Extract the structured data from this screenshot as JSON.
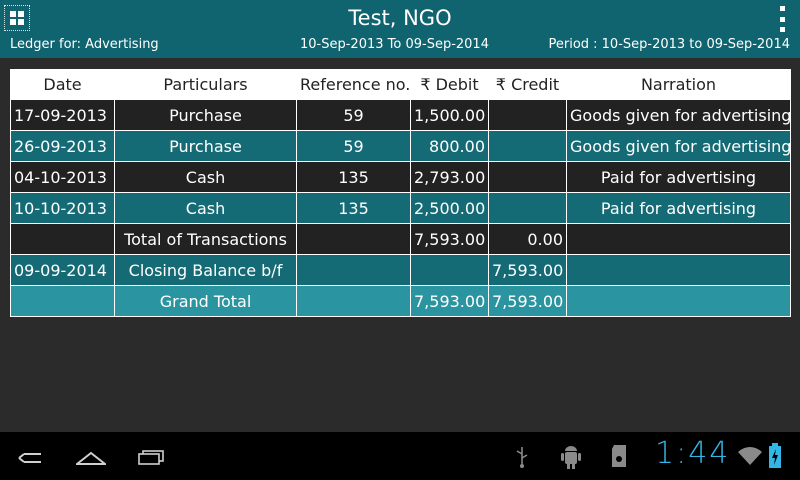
{
  "header": {
    "title": "Test, NGO",
    "ledger_label": "Ledger for: Advertising",
    "date_range": "10-Sep-2013 To 09-Sep-2014",
    "period": "Period : 10-Sep-2013 to 09-Sep-2014",
    "grid_icon": "grid-icon",
    "menu_icon": "overflow-menu-icon"
  },
  "table": {
    "columns": [
      "Date",
      "Particulars",
      "Reference no.",
      "₹ Debit",
      "₹ Credit",
      "Narration"
    ],
    "rows": [
      {
        "date": "17-09-2013",
        "particulars": "Purchase",
        "ref": "59",
        "debit": "1,500.00",
        "credit": "",
        "narration": "Goods given for advertising"
      },
      {
        "date": "26-09-2013",
        "particulars": "Purchase",
        "ref": "59",
        "debit": "800.00",
        "credit": "",
        "narration": "Goods given for advertising"
      },
      {
        "date": "04-10-2013",
        "particulars": "Cash",
        "ref": "135",
        "debit": "2,793.00",
        "credit": "",
        "narration": "Paid for advertising"
      },
      {
        "date": "10-10-2013",
        "particulars": "Cash",
        "ref": "135",
        "debit": "2,500.00",
        "credit": "",
        "narration": "Paid for advertising"
      },
      {
        "date": "",
        "particulars": "Total of Transactions",
        "ref": "",
        "debit": "7,593.00",
        "credit": "0.00",
        "narration": ""
      },
      {
        "date": "09-09-2014",
        "particulars": "Closing Balance b/f",
        "ref": "",
        "debit": "",
        "credit": "7,593.00",
        "narration": ""
      },
      {
        "date": "",
        "particulars": "Grand Total",
        "ref": "",
        "debit": "7,593.00",
        "credit": "7,593.00",
        "narration": ""
      }
    ]
  },
  "statusbar": {
    "time": "1:44",
    "icons": [
      "usb-icon",
      "android-debug-icon",
      "sd-card-icon",
      "wifi-icon",
      "battery-charging-icon"
    ]
  },
  "navbar": {
    "icons": [
      "back-icon",
      "home-icon",
      "recent-apps-icon"
    ]
  },
  "colors": {
    "header_bg": "#0f6470",
    "row_dark": "#222222",
    "row_teal": "#156b75",
    "row_light_teal": "#2a95a0",
    "clock": "#33b5e5"
  }
}
